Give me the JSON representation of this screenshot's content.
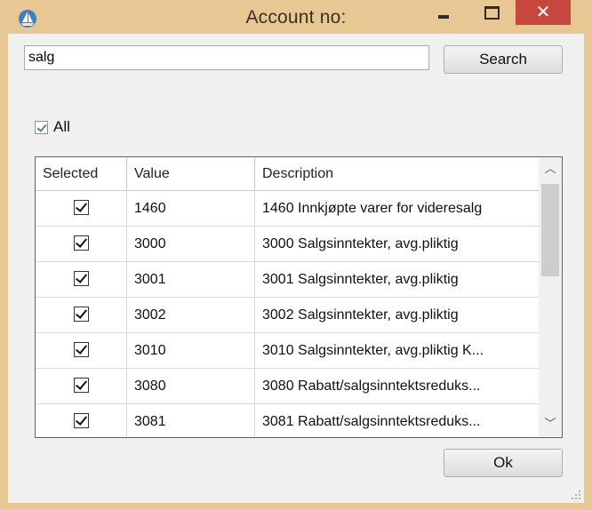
{
  "window": {
    "title": "Account no:",
    "minimize_glyph": "–",
    "maximize_glyph": "□",
    "close_glyph": "✕",
    "accent_color": "#e7c894",
    "close_color": "#c7463d"
  },
  "search": {
    "value": "salg",
    "button_label": "Search"
  },
  "all_checkbox": {
    "label": "All",
    "checked": true
  },
  "table": {
    "columns": [
      "Selected",
      "Value",
      "Description"
    ],
    "rows": [
      {
        "selected": true,
        "value": "1460",
        "description": "1460 Innkjøpte varer for videresalg"
      },
      {
        "selected": true,
        "value": "3000",
        "description": "3000 Salgsinntekter, avg.pliktig"
      },
      {
        "selected": true,
        "value": "3001",
        "description": "3001 Salgsinntekter, avg.pliktig"
      },
      {
        "selected": true,
        "value": "3002",
        "description": "3002 Salgsinntekter, avg.pliktig"
      },
      {
        "selected": true,
        "value": "3010",
        "description": "3010 Salgsinntekter, avg.pliktig K..."
      },
      {
        "selected": true,
        "value": "3080",
        "description": "3080 Rabatt/salgsinntektsreduks..."
      },
      {
        "selected": true,
        "value": "3081",
        "description": "3081 Rabatt/salgsinntektsreduks..."
      }
    ]
  },
  "footer": {
    "ok_label": "Ok"
  }
}
